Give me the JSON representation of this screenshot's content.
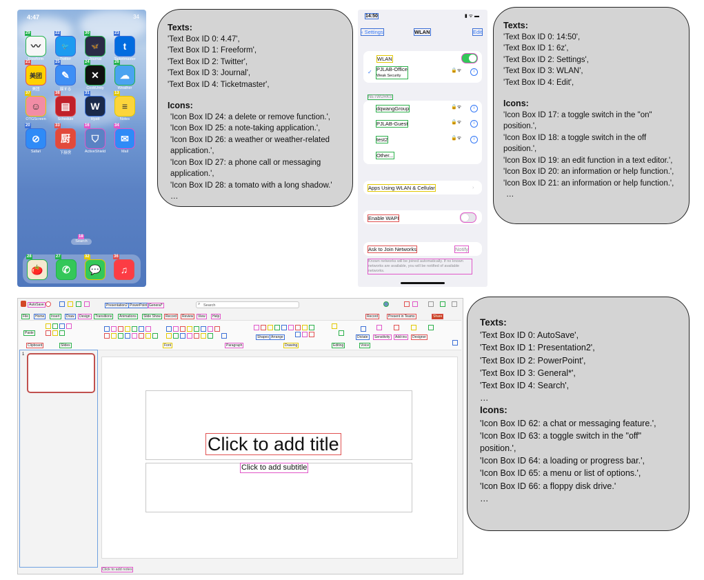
{
  "phone_home": {
    "status_time": "4:47",
    "status_right": "34",
    "apps": [
      {
        "id": "29",
        "label": "Freeform",
        "icon": "freeform-icon",
        "bg": "#f7f7f7",
        "glyph": "〰",
        "border": "#22b14c"
      },
      {
        "id": "22",
        "label": "Twitter",
        "icon": "twitter-bird-icon",
        "bg": "#1d9bf0",
        "glyph": "🐦",
        "border": "#3a6fd8"
      },
      {
        "id": "30",
        "label": "Journal",
        "icon": "journal-butterfly-icon",
        "bg": "#2b2b47",
        "glyph": "🦋",
        "border": "#22b14c"
      },
      {
        "id": "23",
        "label": "Ticketmaster",
        "icon": "ticketmaster-icon",
        "bg": "#026cdf",
        "glyph": "t",
        "border": "#3a6fd8"
      },
      {
        "id": "21",
        "label": "美团",
        "icon": "meituan-icon",
        "bg": "#ffd100",
        "glyph": "美团",
        "border": "#e05050"
      },
      {
        "id": "25",
        "label": "揺する",
        "icon": "note-app-icon",
        "bg": "#3d8ef5",
        "glyph": "✎",
        "border": "#3a6fd8"
      },
      {
        "id": "24",
        "label": "CookUnity",
        "icon": "delete-x-icon",
        "bg": "#111111",
        "glyph": "✕",
        "border": "#22b14c"
      },
      {
        "id": "26",
        "label": "Weather",
        "icon": "weather-cloud-icon",
        "bg": "#4aa3f0",
        "glyph": "☁",
        "border": "#22b14c"
      },
      {
        "id": "37",
        "label": "OTGScreen",
        "icon": "otg-face-icon",
        "bg": "#f28ca5",
        "glyph": "☺",
        "border": "#e2c800"
      },
      {
        "id": "38",
        "label": "Schedule",
        "icon": "newspaper-icon",
        "bg": "#c0202a",
        "glyph": "▤",
        "border": "#e05050"
      },
      {
        "id": "31",
        "label": "Hyatt",
        "icon": "hyatt-icon",
        "bg": "#1b2a4a",
        "glyph": "W",
        "border": "#3a6fd8"
      },
      {
        "id": "13",
        "label": "Notes",
        "icon": "notes-icon",
        "bg": "#fcd53b",
        "glyph": "≡",
        "border": "#e2c800"
      },
      {
        "id": "20",
        "label": "Safari",
        "icon": "safari-compass-icon",
        "bg": "#2f8bf7",
        "glyph": "⊘",
        "border": "#3a6fd8"
      },
      {
        "id": "33",
        "label": "下厨房",
        "icon": "xiachufang-icon",
        "bg": "#e24a3b",
        "glyph": "厨",
        "border": "#e05050"
      },
      {
        "id": "16",
        "label": "ActiveShield",
        "icon": "shield-icon",
        "bg": "#5b82c4",
        "glyph": "⛉",
        "border": "#e056c8"
      },
      {
        "id": "34",
        "label": "Mail",
        "icon": "mail-envelope-icon",
        "bg": "#2f8bf7",
        "glyph": "✉",
        "border": "#e056c8"
      }
    ],
    "search_label": "Search",
    "search_id": "18",
    "dock": [
      {
        "id": "28",
        "icon": "tomato-icon",
        "bg": "#f5e9d0",
        "glyph": "🍅",
        "border": "#22b14c"
      },
      {
        "id": "27",
        "icon": "phone-call-icon",
        "bg": "#34c759",
        "glyph": "✆",
        "border": "#22b14c"
      },
      {
        "id": "32",
        "icon": "messages-chat-icon",
        "bg": "#34c759",
        "glyph": "💬",
        "border": "#e2c800"
      },
      {
        "id": "36",
        "icon": "music-note-icon",
        "bg": "#fc3c44",
        "glyph": "♫",
        "border": "#e05050"
      }
    ]
  },
  "bubble1": {
    "texts_heading": "Texts:",
    "texts": [
      "'Text Box ID 0: 4.47',",
      "'Text Box ID 1: Freeform',",
      "'Text Box ID 2: Twitter',",
      "'Text Box ID 3: Journal',",
      "'Text Box ID 4: Ticketmaster',"
    ],
    "icons_heading": "Icons:",
    "icons": [
      "'Icon Box ID 24: a delete or remove function.',",
      "'Icon Box ID 25: a note-taking application.',",
      "'Icon Box ID 26: a weather or weather-related application.',",
      "'Icon Box ID 27: a phone call or messaging application.',",
      "'Icon Box ID 28: a tomato with a long shadow.'"
    ],
    "ellipsis": "…"
  },
  "settings": {
    "time": "14:50",
    "back_label": "Settings",
    "title": "WLAN",
    "edit_label": "Edit",
    "wlan_label": "WLAN",
    "connected_network": "PJLAB-Office",
    "connected_sub": "Weak Security",
    "networks_header": "NETWORKS",
    "networks": [
      "dqwangGroup",
      "PJLAB-Guest",
      "test2",
      "Other..."
    ],
    "apps_using": "Apps Using WLAN & Cellular",
    "enable_wapi": "Enable WAPI",
    "ask_join": "Ask to Join Networks",
    "notify": "Notify",
    "footer_note": "Known networks will be joined automatically. If no known networks are available, you will be notified of available networks."
  },
  "bubble2": {
    "texts_heading": "Texts:",
    "texts": [
      "'Text Box ID 0: 14:50',",
      "'Text Box ID 1: 6z',",
      "'Text Box ID 2: Settings',",
      "'Text Box ID 3: WLAN',",
      "'Text Box ID 4: Edit',"
    ],
    "icons_heading": "Icons:",
    "icons": [
      "'Icon Box ID 17: a toggle switch in the \"on\" position.',",
      "'Icon Box ID 18: a toggle switch in the off position.',",
      "'Icon Box ID 19: an edit function in a text editor.',",
      "'Icon Box ID 20: an information or help function.',",
      "'Icon Box ID 21: an information or help function.',"
    ],
    "ellipsis": "…"
  },
  "ppt": {
    "autosave": "AutoSave",
    "filename": "Presentation2",
    "app": "PowerPoint",
    "label": "General*",
    "search": "Search",
    "tabs": [
      "File",
      "Home",
      "Insert",
      "Draw",
      "Design",
      "Transitions",
      "Animations",
      "Slide Show",
      "Record",
      "Review",
      "View",
      "Help"
    ],
    "record_btn": "Record",
    "present_btn": "Present in Teams",
    "share_btn": "Share",
    "ribbon_groups": [
      "Paste",
      "Clipboard",
      "Slides",
      "Font",
      "Paragraph",
      "Drawing",
      "Shapes",
      "Arrange",
      "Editing",
      "Voice",
      "Dictate",
      "Sensitivity",
      "Add-ins",
      "Designer"
    ],
    "slide_title": "Click to add title",
    "slide_subtitle": "Click to add subtitle",
    "notes": "Click to add notes",
    "thumb_no": "1"
  },
  "bubble3": {
    "texts_heading": "Texts:",
    "texts": [
      "'Text Box ID 0: AutoSave',",
      "'Text Box ID 1: Presentation2',",
      "'Text Box ID 2: PowerPoint',",
      "'Text Box ID 3: General*',",
      "'Text Box ID 4: Search',"
    ],
    "texts_ellipsis": "…",
    "icons_heading": "Icons:",
    "icons": [
      "'Icon Box ID 62: a chat or messaging feature.',",
      "'Icon Box ID 63: a toggle switch in the \"off\" position.',",
      "'Icon Box ID 64: a loading or progress bar.',",
      "'Icon Box ID 65: a menu or list of options.',",
      "'Icon Box ID 66: a floppy disk drive.'"
    ],
    "ellipsis": "…"
  }
}
